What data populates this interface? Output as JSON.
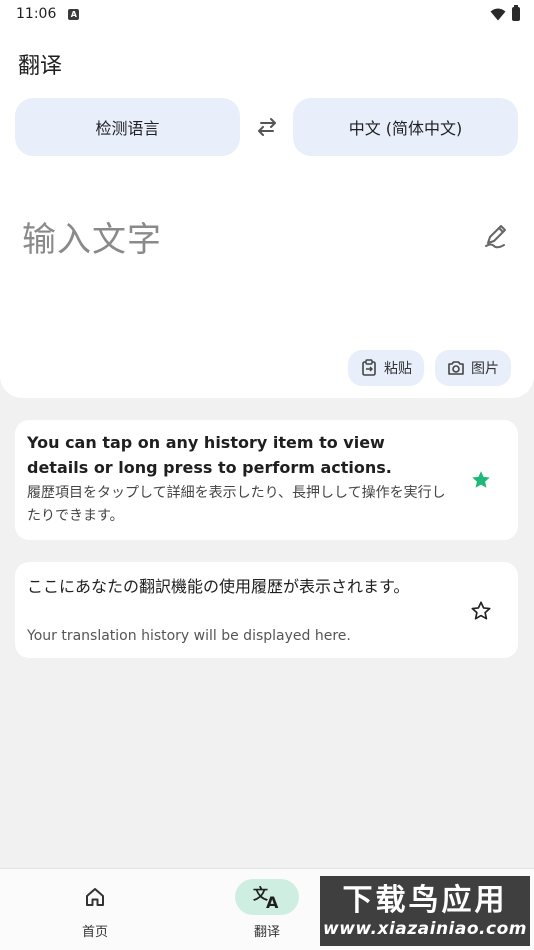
{
  "status_bar": {
    "time": "11:06",
    "notification_icon": "a-icon",
    "wifi_icon": "wifi-icon",
    "battery_icon": "battery-icon"
  },
  "app": {
    "title": "翻译"
  },
  "languages": {
    "source": "检测语言",
    "target": "中文 (简体中文)",
    "swap_icon": "swap-icon"
  },
  "input": {
    "placeholder": "输入文字",
    "handwriting_icon": "handwriting-icon"
  },
  "actions": {
    "paste_label": "粘贴",
    "image_label": "图片"
  },
  "history": [
    {
      "title": "You can tap on any history item to view details or long press to perform actions.",
      "subtitle": "履歴項目をタップして詳細を表示したり、長押しして操作を実行したりできます。",
      "starred": true
    },
    {
      "title": "ここにあなたの翻訳機能の使用履歴が表示されます。",
      "subtitle": "Your translation history will be displayed here.",
      "starred": false
    }
  ],
  "bottom_nav": {
    "items": [
      {
        "label": "首页",
        "icon": "home-icon",
        "active": false
      },
      {
        "label": "翻译",
        "icon": "translate-icon",
        "active": true
      }
    ]
  },
  "watermark": {
    "brand": "下载鸟应用",
    "url": "www.xiazainiao.com"
  },
  "colors": {
    "accent_chip": "#e8effb",
    "nav_active": "#cfeee2",
    "star_filled": "#1db87a",
    "background": "#f1f1f1"
  }
}
